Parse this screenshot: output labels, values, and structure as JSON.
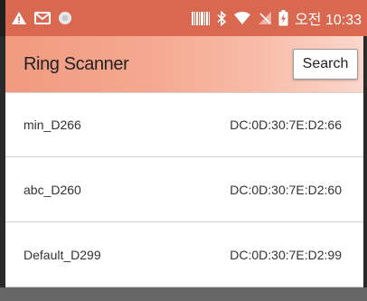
{
  "status_bar": {
    "icons_left": [
      "warning-icon",
      "mail-icon",
      "record-icon"
    ],
    "icons_right": [
      "barcode-icon",
      "bluetooth-icon",
      "wifi-icon",
      "no-signal-icon",
      "battery-charging-icon"
    ],
    "clock": "오전 10:33"
  },
  "app_bar": {
    "title": "Ring Scanner",
    "search_label": "Search"
  },
  "devices": [
    {
      "name": "min_D266",
      "mac": "DC:0D:30:7E:D2:66"
    },
    {
      "name": "abc_D260",
      "mac": "DC:0D:30:7E:D2:60"
    },
    {
      "name": "Default_D299",
      "mac": "DC:0D:30:7E:D2:99"
    }
  ],
  "colors": {
    "status_bar": "#d96850",
    "app_bar_start": "#f09a80",
    "app_bar_end": "#fbd7cc",
    "list_divider": "#cfcfcf",
    "bottom_bar": "#666666"
  }
}
